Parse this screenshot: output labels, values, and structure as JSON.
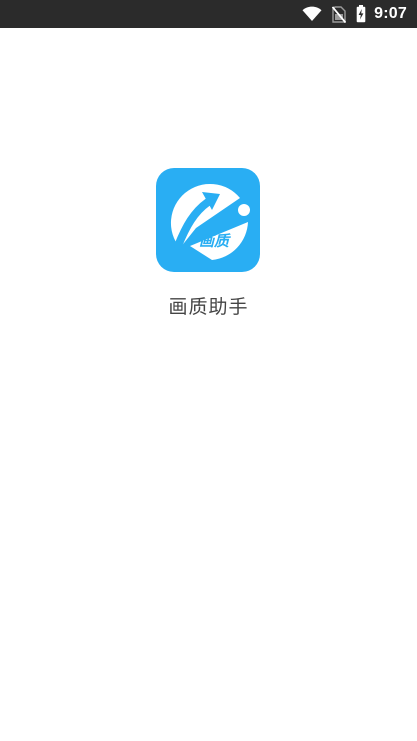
{
  "status_bar": {
    "time": "9:07",
    "icons": [
      "wifi-icon",
      "no-sim-icon",
      "battery-charging-icon"
    ]
  },
  "app": {
    "logo_text": "画质",
    "name": "画质助手"
  },
  "colors": {
    "status_bar_bg": "#2b2b2b",
    "brand_blue": "#29aef3",
    "background": "#ffffff",
    "app_name_text": "#444444"
  }
}
